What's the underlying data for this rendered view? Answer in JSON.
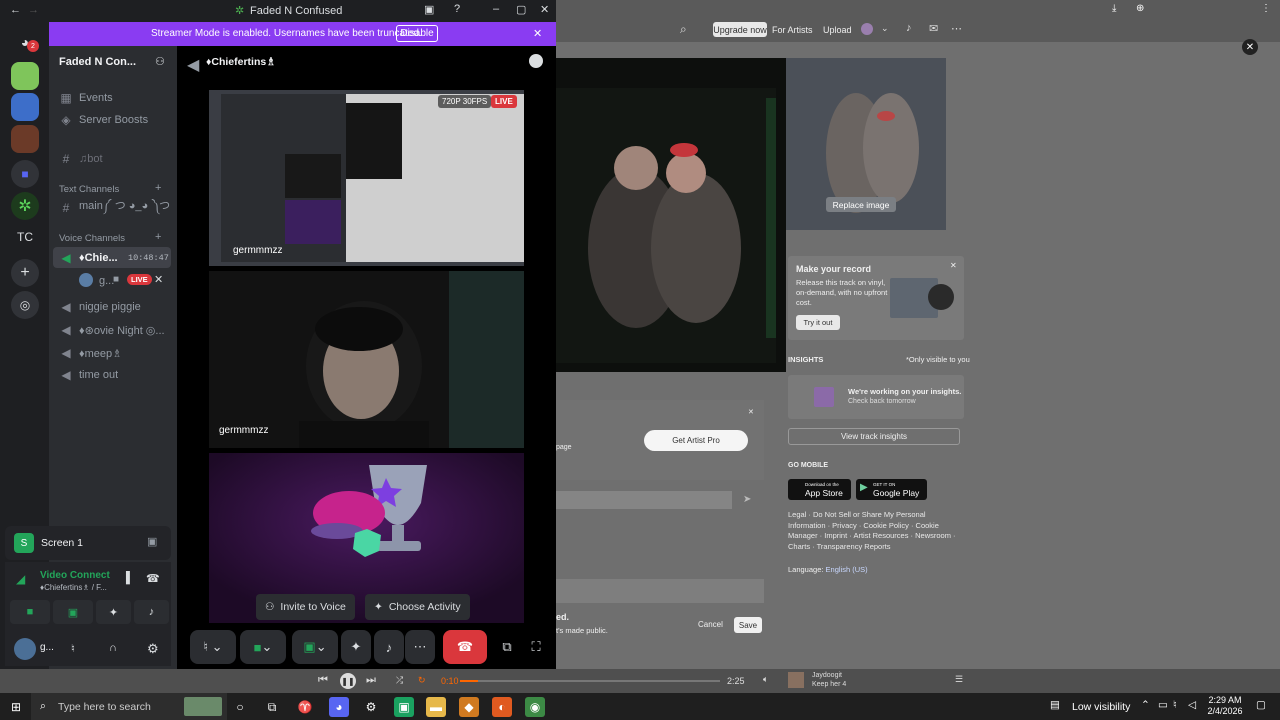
{
  "window": {
    "title": "Faded N Confused"
  },
  "banner": {
    "text": "Streamer Mode is enabled. Usernames have been truncated.",
    "disable_label": "Disable"
  },
  "guilds": {
    "home_badge": "2",
    "tc_label": "TC"
  },
  "server": {
    "name": "Faded N Con..."
  },
  "channels": {
    "events": "Events",
    "boosts": "Server Boosts",
    "bot": "♫bot",
    "text_header": "Text Channels",
    "main": "main༼ つ ◕_◕ ༽つ",
    "voice_header": "Voice Channels",
    "chiefer": "♦Chie...",
    "chiefer_time": "10:48:47",
    "user_short": "g...",
    "live": "LIVE",
    "niggie": "niggie piggie",
    "movie": "♦⊛ovie Night ◎...",
    "meep": "♦meep♗",
    "timeout": "time out"
  },
  "screen_panel": {
    "title": "Screen 1"
  },
  "voice_panel": {
    "status": "Video Connect",
    "sub": "♦Chiefertins♗ / F..."
  },
  "user_panel": {
    "name": "g..."
  },
  "stage": {
    "channel_title": "♦Chiefertins♗",
    "tile1_badge": "720P 30FPS",
    "tile1_live": "LIVE",
    "tile1_name": "germmmzz",
    "tile2_name": "germmmzz",
    "invite_label": "Invite to Voice",
    "activity_label": "Choose Activity"
  },
  "soundcloud": {
    "upgrade": "Upgrade now",
    "for_artists": "For Artists",
    "upload": "Upload",
    "replace_image": "Replace image",
    "make_record_title": "Make your record",
    "make_record_text": "Release this track on vinyl, on-demand, with no upfront cost.",
    "try_it": "Try it out",
    "insights_label": "INSIGHTS",
    "only_visible": "*Only visible to you",
    "working_title": "We're working on your insights.",
    "check_back": "Check back tomorrow",
    "view_insights": "View track insights",
    "get_artist_pro": "Get Artist Pro",
    "page_text": "page",
    "go_mobile": "GO MOBILE",
    "app_store_top": "Download on the",
    "app_store": "App Store",
    "google_top": "GET IT ON",
    "google_play": "Google Play",
    "footer_links": "Legal · Do Not Sell or Share My Personal Information · Privacy · Cookie Policy · Cookie Manager · Imprint · Artist Resources · Newsroom · Charts · Transparency Reports",
    "language_label": "Language:",
    "language_value": "English (US)",
    "made_public_title": "ed.",
    "made_public_text": "t's made public.",
    "cancel": "Cancel",
    "save": "Save"
  },
  "player": {
    "elapsed": "0:10",
    "duration": "2:25",
    "track_user": "Jaydoogit",
    "track_title": "Keep her 4"
  },
  "taskbar": {
    "search": "Type here to search",
    "visibility": "Low visibility",
    "time": "2:29 AM",
    "date": "2/4/2026"
  },
  "colors": {
    "accent": "#8a3cf2",
    "live": "#da373c",
    "online": "#23a55a",
    "hangup": "#da373c"
  }
}
